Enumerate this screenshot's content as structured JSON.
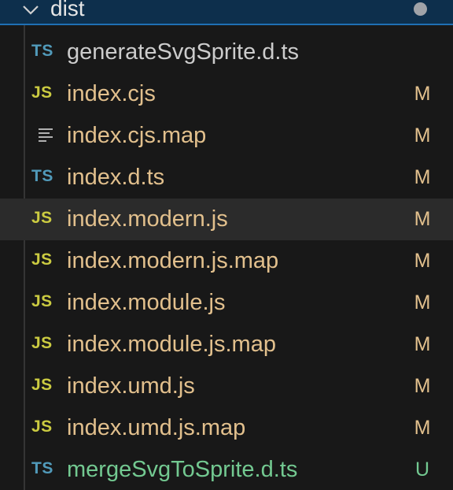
{
  "folder": {
    "name": "dist",
    "expanded": true
  },
  "files": [
    {
      "name": "generateSvgSprite.d.ts",
      "type": "TS",
      "icon": "typescript-icon",
      "status": "",
      "state": "plain"
    },
    {
      "name": "index.cjs",
      "type": "JS",
      "icon": "javascript-icon",
      "status": "M",
      "state": "modified"
    },
    {
      "name": "index.cjs.map",
      "type": "",
      "icon": "lines-file-icon",
      "status": "M",
      "state": "modified"
    },
    {
      "name": "index.d.ts",
      "type": "TS",
      "icon": "typescript-icon",
      "status": "M",
      "state": "modified"
    },
    {
      "name": "index.modern.js",
      "type": "JS",
      "icon": "javascript-icon",
      "status": "M",
      "state": "modified",
      "hovered": true
    },
    {
      "name": "index.modern.js.map",
      "type": "JS",
      "icon": "javascript-icon",
      "status": "M",
      "state": "modified"
    },
    {
      "name": "index.module.js",
      "type": "JS",
      "icon": "javascript-icon",
      "status": "M",
      "state": "modified"
    },
    {
      "name": "index.module.js.map",
      "type": "JS",
      "icon": "javascript-icon",
      "status": "M",
      "state": "modified"
    },
    {
      "name": "index.umd.js",
      "type": "JS",
      "icon": "javascript-icon",
      "status": "M",
      "state": "modified"
    },
    {
      "name": "index.umd.js.map",
      "type": "JS",
      "icon": "javascript-icon",
      "status": "M",
      "state": "modified"
    },
    {
      "name": "mergeSvgToSprite.d.ts",
      "type": "TS",
      "icon": "typescript-icon",
      "status": "U",
      "state": "untracked"
    }
  ],
  "colors": {
    "modified": "#e2c08d",
    "untracked": "#73c991",
    "ts": "#519aba",
    "js": "#cbcb41",
    "selection": "#0d2f4c"
  }
}
